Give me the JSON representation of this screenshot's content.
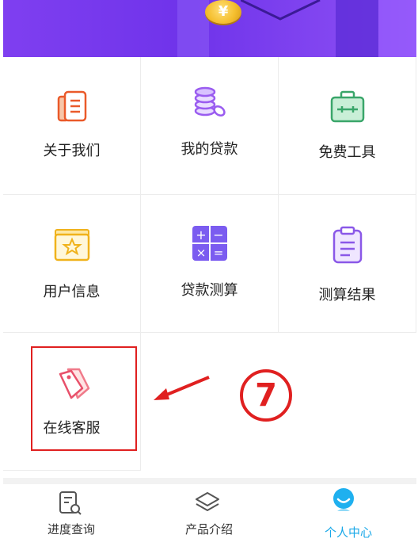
{
  "banner": {
    "coin_symbol": "¥"
  },
  "grid": {
    "items": [
      {
        "label": "关于我们",
        "icon": "document-icon"
      },
      {
        "label": "我的贷款",
        "icon": "coins-icon"
      },
      {
        "label": "免费工具",
        "icon": "toolbox-icon"
      },
      {
        "label": "用户信息",
        "icon": "folder-star-icon"
      },
      {
        "label": "贷款测算",
        "icon": "calculator-icon"
      },
      {
        "label": "测算结果",
        "icon": "clipboard-icon"
      },
      {
        "label": "在线客服",
        "icon": "tags-icon"
      }
    ]
  },
  "annotation": {
    "step_number": "7",
    "highlight_color": "#e02020"
  },
  "tabbar": {
    "tabs": [
      {
        "label": "进度查询",
        "icon": "search-document-icon",
        "active": false
      },
      {
        "label": "产品介绍",
        "icon": "layers-icon",
        "active": false
      },
      {
        "label": "个人中心",
        "icon": "user-avatar-icon",
        "active": true
      }
    ],
    "active_color": "#19a8e8"
  }
}
